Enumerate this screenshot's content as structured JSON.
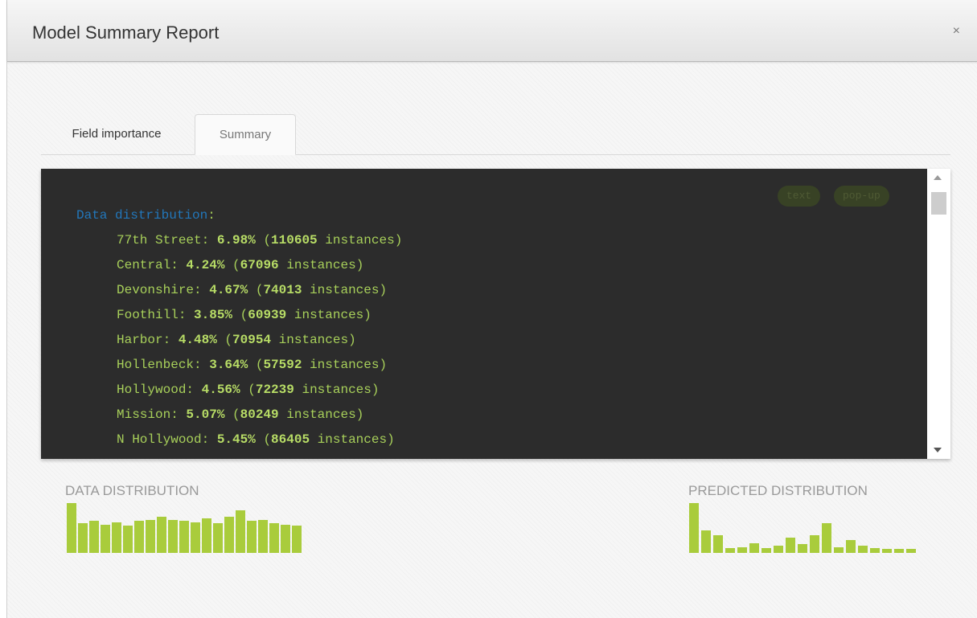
{
  "modal": {
    "title": "Model Summary Report",
    "close_label": "×"
  },
  "tabs": [
    {
      "label": "Field importance",
      "active": false
    },
    {
      "label": "Summary",
      "active": true
    }
  ],
  "code_panel": {
    "buttons": [
      "text",
      "pop-up"
    ],
    "heading": "Data distribution",
    "entries": [
      {
        "name": "77th Street",
        "percent": "6.98%",
        "instances": "110605"
      },
      {
        "name": "Central",
        "percent": "4.24%",
        "instances": "67096"
      },
      {
        "name": "Devonshire",
        "percent": "4.67%",
        "instances": "74013"
      },
      {
        "name": "Foothill",
        "percent": "3.85%",
        "instances": "60939"
      },
      {
        "name": "Harbor",
        "percent": "4.48%",
        "instances": "70954"
      },
      {
        "name": "Hollenbeck",
        "percent": "3.64%",
        "instances": "57592"
      },
      {
        "name": "Hollywood",
        "percent": "4.56%",
        "instances": "72239"
      },
      {
        "name": "Mission",
        "percent": "5.07%",
        "instances": "80249"
      },
      {
        "name": "N Hollywood",
        "percent": "5.45%",
        "instances": "86405"
      }
    ],
    "instances_word": "instances"
  },
  "distributions": {
    "data_label": "DATA DISTRIBUTION",
    "predicted_label": "PREDICTED DISTRIBUTION",
    "bar_color": "#a9cc3c",
    "data_bars": [
      1.0,
      0.6,
      0.65,
      0.57,
      0.62,
      0.55,
      0.64,
      0.66,
      0.72,
      0.66,
      0.64,
      0.62,
      0.7,
      0.6,
      0.72,
      0.85,
      0.64,
      0.66,
      0.6,
      0.57,
      0.55
    ],
    "predicted_bars": [
      1.0,
      0.45,
      0.35,
      0.1,
      0.12,
      0.2,
      0.1,
      0.15,
      0.3,
      0.18,
      0.35,
      0.6,
      0.12,
      0.25,
      0.15,
      0.1,
      0.08,
      0.08,
      0.08
    ]
  },
  "colors": {
    "code_background": "#2c2c2c",
    "code_text": "#a8d05a",
    "code_heading": "#2277bb"
  }
}
